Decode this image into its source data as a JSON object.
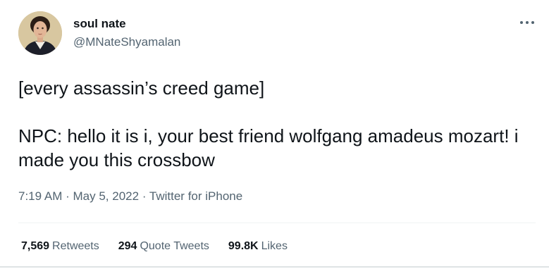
{
  "user": {
    "display_name": "soul nate",
    "handle": "@MNateShyamalan",
    "avatar_icon": "portrait-avatar"
  },
  "more_icon": "more-horizontal-icon",
  "tweet": {
    "text": "[every assassin’s creed game]\n\nNPC: hello it is i, your best friend wolfgang amadeus mozart! i made you this crossbow"
  },
  "meta": {
    "time": "7:19 AM",
    "separator": "·",
    "date": "May 5, 2022",
    "source": "Twitter for iPhone"
  },
  "stats": {
    "retweets_count": "7,569",
    "retweets_label": "Retweets",
    "quotes_count": "294",
    "quotes_label": "Quote Tweets",
    "likes_count": "99.8K",
    "likes_label": "Likes"
  },
  "colors": {
    "text_primary": "#0f1419",
    "text_secondary": "#536471",
    "divider": "#eff3f4"
  }
}
